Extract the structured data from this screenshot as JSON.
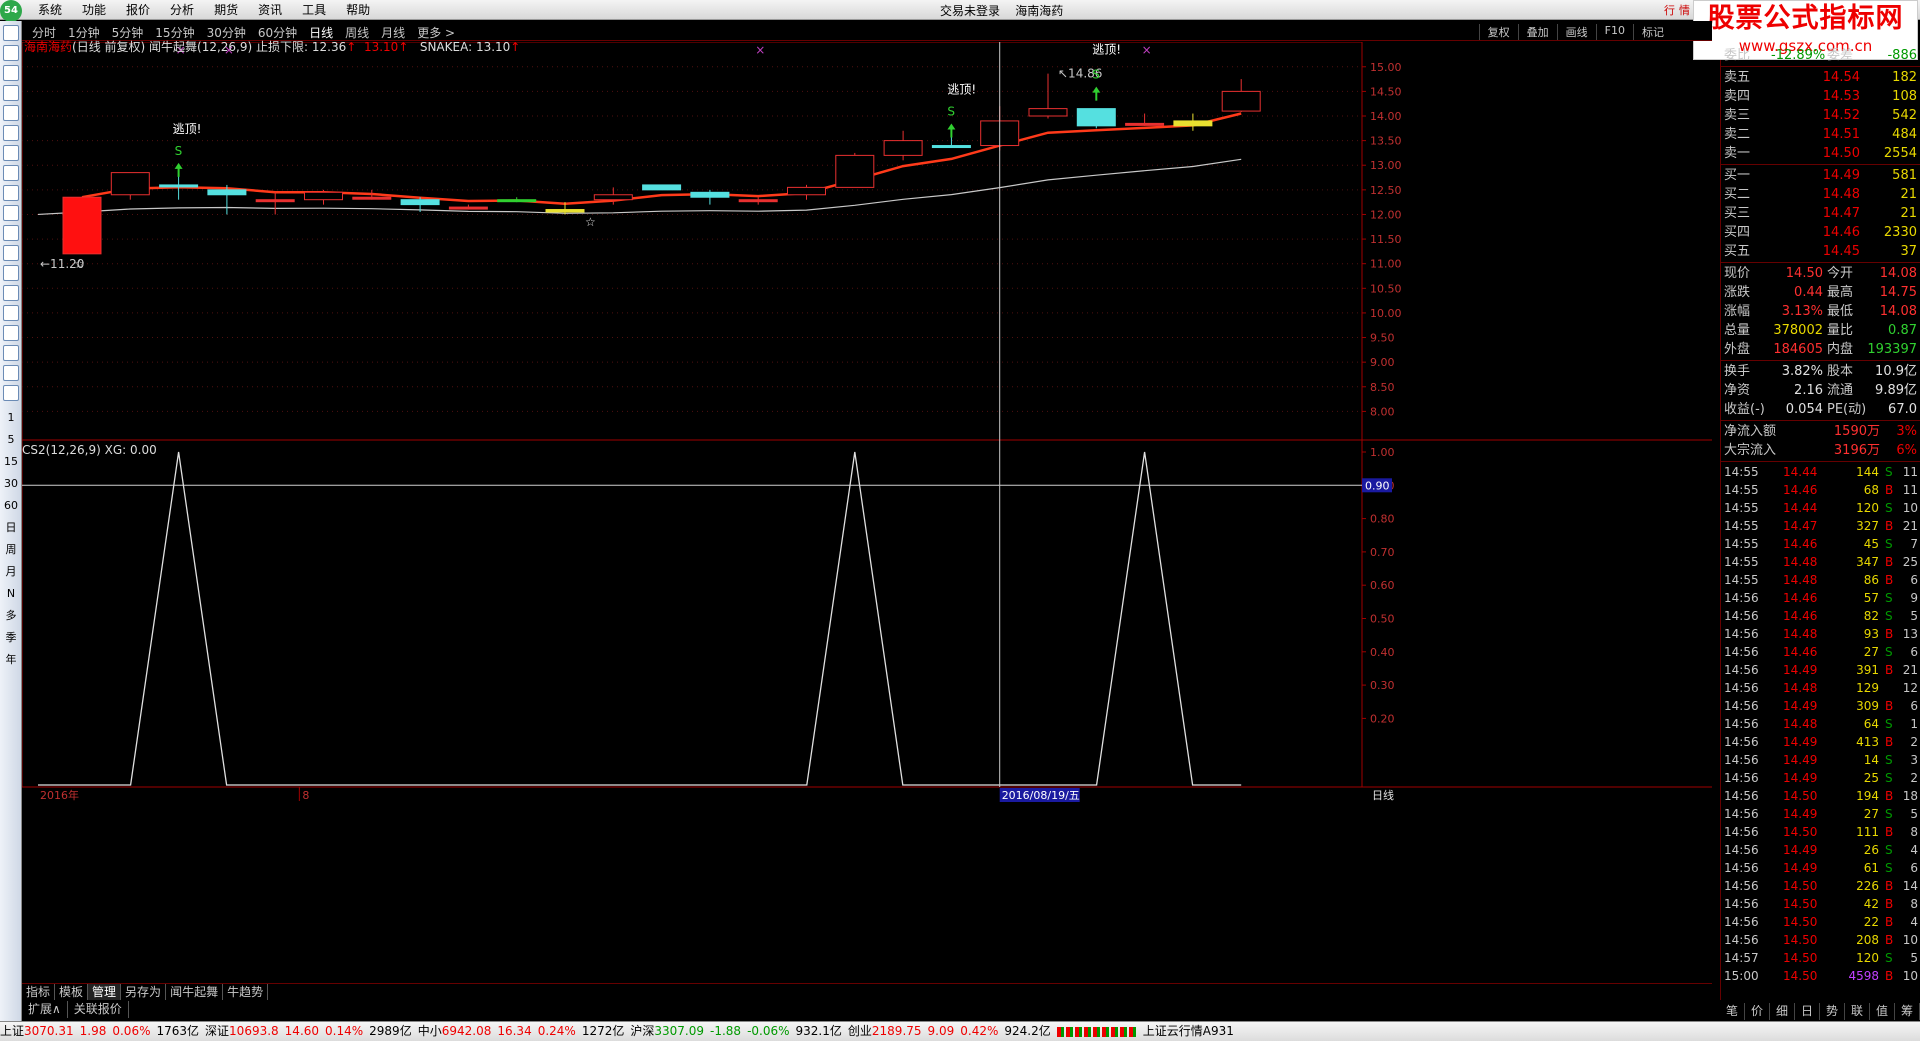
{
  "app": {
    "logo": "54",
    "menu": [
      "系统",
      "功能",
      "报价",
      "分析",
      "期货",
      "资讯",
      "工具",
      "帮助"
    ],
    "login_status": "交易未登录",
    "stock_name": "海南海药",
    "win_btns": [
      "行",
      "情"
    ]
  },
  "brand": {
    "title": "股票公式指标网",
    "url": "www.gszx.com.cn"
  },
  "periods": [
    "分时",
    "1分钟",
    "5分钟",
    "15分钟",
    "30分钟",
    "60分钟",
    "日线",
    "周线",
    "月线",
    "更多 >"
  ],
  "active_period": "日线",
  "tools": [
    "复权",
    "叠加",
    "画线",
    "F10",
    "标记"
  ],
  "left_periods": [
    "1",
    "5",
    "15",
    "30",
    "60",
    "日",
    "周",
    "月",
    "N",
    "多",
    "季",
    "年"
  ],
  "left_icons": [
    "up",
    "down",
    "k",
    "tbl",
    "line",
    "kline",
    "F10",
    "F",
    "bar",
    "F12",
    "F16",
    "clock",
    "wave",
    "RSI",
    "S",
    "move",
    "pen",
    "F5",
    "sync"
  ],
  "header": {
    "name": "海南海药",
    "desc": "(日线 前复权) 闻牛起舞(12,26,9)",
    "limit_label": "止损下限:",
    "limit_val": "12.36",
    "extra_val": "13.10",
    "snake": "SNAKEA: 13.10"
  },
  "chart_data": [
    {
      "type": "candlestick",
      "ylim": [
        7.5,
        15.3
      ],
      "yticks": [
        8.0,
        8.5,
        9.0,
        9.5,
        10.0,
        10.5,
        11.0,
        11.5,
        12.0,
        12.5,
        13.0,
        13.5,
        14.0,
        14.5,
        15.0
      ],
      "candles": [
        {
          "o": 11.2,
          "c": 12.35,
          "h": 12.35,
          "l": 11.2,
          "color": "red_fill"
        },
        {
          "o": 12.4,
          "c": 12.85,
          "h": 12.85,
          "l": 12.3,
          "color": "red"
        },
        {
          "o": 12.6,
          "c": 12.6,
          "h": 12.9,
          "l": 12.3,
          "color": "cyan_line"
        },
        {
          "o": 12.4,
          "c": 12.5,
          "h": 12.6,
          "l": 12.0,
          "color": "cyan"
        },
        {
          "o": 12.25,
          "c": 12.3,
          "h": 12.45,
          "l": 12.0,
          "color": "red_line"
        },
        {
          "o": 12.3,
          "c": 12.45,
          "h": 12.5,
          "l": 12.2,
          "color": "red"
        },
        {
          "o": 12.35,
          "c": 12.35,
          "h": 12.5,
          "l": 12.3,
          "color": "red_line"
        },
        {
          "o": 12.3,
          "c": 12.2,
          "h": 12.35,
          "l": 12.05,
          "color": "cyan"
        },
        {
          "o": 12.15,
          "c": 12.15,
          "h": 12.2,
          "l": 12.1,
          "color": "red_line"
        },
        {
          "o": 12.3,
          "c": 12.3,
          "h": 12.35,
          "l": 12.25,
          "color": "green_line"
        },
        {
          "o": 12.05,
          "c": 12.1,
          "h": 12.25,
          "l": 12.0,
          "color": "yellow"
        },
        {
          "o": 12.3,
          "c": 12.4,
          "h": 12.55,
          "l": 12.2,
          "color": "red"
        },
        {
          "o": 12.5,
          "c": 12.6,
          "h": 12.6,
          "l": 12.5,
          "color": "cyan"
        },
        {
          "o": 12.35,
          "c": 12.45,
          "h": 12.5,
          "l": 12.2,
          "color": "cyan"
        },
        {
          "o": 12.3,
          "c": 12.3,
          "h": 12.35,
          "l": 12.2,
          "color": "red_line"
        },
        {
          "o": 12.4,
          "c": 12.55,
          "h": 12.6,
          "l": 12.3,
          "color": "red"
        },
        {
          "o": 12.55,
          "c": 13.2,
          "h": 13.25,
          "l": 12.55,
          "color": "red"
        },
        {
          "o": 13.2,
          "c": 13.5,
          "h": 13.7,
          "l": 13.1,
          "color": "red"
        },
        {
          "o": 13.4,
          "c": 13.4,
          "h": 13.75,
          "l": 13.35,
          "color": "cyan_line"
        },
        {
          "o": 13.4,
          "c": 13.9,
          "h": 14.2,
          "l": 13.3,
          "color": "red"
        },
        {
          "o": 14.0,
          "c": 14.15,
          "h": 14.86,
          "l": 13.95,
          "color": "red"
        },
        {
          "o": 14.15,
          "c": 13.8,
          "h": 14.15,
          "l": 13.75,
          "color": "cyan"
        },
        {
          "o": 13.85,
          "c": 13.85,
          "h": 14.05,
          "l": 13.8,
          "color": "red_line"
        },
        {
          "o": 13.8,
          "c": 13.9,
          "h": 14.05,
          "l": 13.7,
          "color": "yellow"
        },
        {
          "o": 14.1,
          "c": 14.5,
          "h": 14.75,
          "l": 14.08,
          "color": "red"
        }
      ],
      "labels": {
        "low_mark": "11.20",
        "high_mark": "14.86",
        "escape": "逃顶!",
        "sell": "S"
      }
    },
    {
      "type": "line",
      "title": "CS2(12,26,9)  XG: 0.00",
      "ylim": [
        0,
        1.0
      ],
      "yticks": [
        0.2,
        0.3,
        0.4,
        0.5,
        0.6,
        0.7,
        0.8,
        0.9,
        1.0
      ],
      "hline": 0.9,
      "hline_label": "0.90",
      "peaks": [
        2,
        16,
        22
      ]
    }
  ],
  "x_axis": {
    "year_label": "2016年",
    "month_label": "8",
    "cursor_date": "2016/08/19/五",
    "right_label": "日线"
  },
  "quote": {
    "weibi": {
      "k": "委比",
      "v": "-12.89%",
      "k2": "委差",
      "v2": "-886"
    },
    "asks": [
      {
        "k": "卖五",
        "p": "14.54",
        "n": "182"
      },
      {
        "k": "卖四",
        "p": "14.53",
        "n": "108"
      },
      {
        "k": "卖三",
        "p": "14.52",
        "n": "542"
      },
      {
        "k": "卖二",
        "p": "14.51",
        "n": "484"
      },
      {
        "k": "卖一",
        "p": "14.50",
        "n": "2554"
      }
    ],
    "bids": [
      {
        "k": "买一",
        "p": "14.49",
        "n": "581"
      },
      {
        "k": "买二",
        "p": "14.48",
        "n": "21"
      },
      {
        "k": "买三",
        "p": "14.47",
        "n": "21"
      },
      {
        "k": "买四",
        "p": "14.46",
        "n": "2330"
      },
      {
        "k": "买五",
        "p": "14.45",
        "n": "37"
      }
    ],
    "stats": [
      {
        "k": "现价",
        "v": "14.50",
        "vc": "red",
        "k2": "今开",
        "v2": "14.08",
        "v2c": "red"
      },
      {
        "k": "涨跌",
        "v": "0.44",
        "vc": "red",
        "k2": "最高",
        "v2": "14.75",
        "v2c": "red"
      },
      {
        "k": "涨幅",
        "v": "3.13%",
        "vc": "red",
        "k2": "最低",
        "v2": "14.08",
        "v2c": "red"
      },
      {
        "k": "总量",
        "v": "378002",
        "vc": "yellow",
        "k2": "量比",
        "v2": "0.87",
        "v2c": "green"
      },
      {
        "k": "外盘",
        "v": "184605",
        "vc": "red",
        "k2": "内盘",
        "v2": "193397",
        "v2c": "green"
      }
    ],
    "stats2": [
      {
        "k": "换手",
        "v": "3.82%",
        "vc": "white",
        "k2": "股本",
        "v2": "10.9亿",
        "v2c": "white"
      },
      {
        "k": "净资",
        "v": "2.16",
        "vc": "white",
        "k2": "流通",
        "v2": "9.89亿",
        "v2c": "white"
      },
      {
        "k": "收益(-)",
        "v": "0.054",
        "vc": "white",
        "k2": "PE(动)",
        "v2": "67.0",
        "v2c": "white"
      }
    ],
    "flows": [
      {
        "k": "净流入额",
        "v": "1590万",
        "p": "3%"
      },
      {
        "k": "大宗流入",
        "v": "3196万",
        "p": "6%"
      }
    ]
  },
  "ticks": [
    {
      "t": "14:55",
      "p": "14.44",
      "q": "144",
      "d": "S",
      "c": "11"
    },
    {
      "t": "14:55",
      "p": "14.46",
      "q": "68",
      "d": "B",
      "c": "11"
    },
    {
      "t": "14:55",
      "p": "14.44",
      "q": "120",
      "d": "S",
      "c": "10"
    },
    {
      "t": "14:55",
      "p": "14.47",
      "q": "327",
      "d": "B",
      "c": "21"
    },
    {
      "t": "14:55",
      "p": "14.46",
      "q": "45",
      "d": "S",
      "c": "7"
    },
    {
      "t": "14:55",
      "p": "14.48",
      "q": "347",
      "d": "B",
      "c": "25"
    },
    {
      "t": "14:55",
      "p": "14.48",
      "q": "86",
      "d": "B",
      "c": "6"
    },
    {
      "t": "14:56",
      "p": "14.46",
      "q": "57",
      "d": "S",
      "c": "9"
    },
    {
      "t": "14:56",
      "p": "14.46",
      "q": "82",
      "d": "S",
      "c": "5"
    },
    {
      "t": "14:56",
      "p": "14.48",
      "q": "93",
      "d": "B",
      "c": "13"
    },
    {
      "t": "14:56",
      "p": "14.46",
      "q": "27",
      "d": "S",
      "c": "6"
    },
    {
      "t": "14:56",
      "p": "14.49",
      "q": "391",
      "d": "B",
      "c": "21"
    },
    {
      "t": "14:56",
      "p": "14.48",
      "q": "129",
      "d": "",
      "c": "12"
    },
    {
      "t": "14:56",
      "p": "14.49",
      "q": "309",
      "d": "B",
      "c": "6"
    },
    {
      "t": "14:56",
      "p": "14.48",
      "q": "64",
      "d": "S",
      "c": "1"
    },
    {
      "t": "14:56",
      "p": "14.49",
      "q": "413",
      "d": "B",
      "c": "2"
    },
    {
      "t": "14:56",
      "p": "14.49",
      "q": "14",
      "d": "S",
      "c": "3"
    },
    {
      "t": "14:56",
      "p": "14.49",
      "q": "25",
      "d": "S",
      "c": "2"
    },
    {
      "t": "14:56",
      "p": "14.50",
      "q": "194",
      "d": "B",
      "c": "18"
    },
    {
      "t": "14:56",
      "p": "14.49",
      "q": "27",
      "d": "S",
      "c": "5"
    },
    {
      "t": "14:56",
      "p": "14.50",
      "q": "111",
      "d": "B",
      "c": "8"
    },
    {
      "t": "14:56",
      "p": "14.49",
      "q": "26",
      "d": "S",
      "c": "4"
    },
    {
      "t": "14:56",
      "p": "14.49",
      "q": "61",
      "d": "S",
      "c": "6"
    },
    {
      "t": "14:56",
      "p": "14.50",
      "q": "226",
      "d": "B",
      "c": "14"
    },
    {
      "t": "14:56",
      "p": "14.50",
      "q": "42",
      "d": "B",
      "c": "8"
    },
    {
      "t": "14:56",
      "p": "14.50",
      "q": "22",
      "d": "B",
      "c": "4"
    },
    {
      "t": "14:56",
      "p": "14.50",
      "q": "208",
      "d": "B",
      "c": "10"
    },
    {
      "t": "14:57",
      "p": "14.50",
      "q": "120",
      "d": "S",
      "c": "5"
    },
    {
      "t": "15:00",
      "p": "14.50",
      "q": "4598",
      "d": "B",
      "c": "10"
    }
  ],
  "right_tabs": [
    "笔",
    "价",
    "细",
    "日",
    "势",
    "联",
    "值",
    "筹"
  ],
  "tabs1": [
    "指标",
    "模板",
    "管理",
    "另存为",
    "闻牛起舞",
    "牛趋势"
  ],
  "tabs1_active": "管理",
  "tabs2": [
    "扩展∧",
    "关联报价"
  ],
  "status": [
    {
      "k": "上证",
      "v": "3070.31",
      "c": "1.98",
      "p": "0.06%",
      "a": "1763亿"
    },
    {
      "k": "深证",
      "v": "10693.8",
      "c": "14.60",
      "p": "0.14%",
      "a": "2989亿"
    },
    {
      "k": "中小",
      "v": "6942.08",
      "c": "16.34",
      "p": "0.24%",
      "a": "1272亿"
    },
    {
      "k": "沪深",
      "v": "3307.09",
      "c": "-1.88",
      "p": "-0.06%",
      "a": "932.1亿"
    },
    {
      "k": "创业",
      "v": "2189.75",
      "c": "9.09",
      "p": "0.42%",
      "a": "924.2亿"
    }
  ],
  "status_tail": "上证云行情A931",
  "colors": {
    "up": "#e83030",
    "down": "#55e0e0",
    "ma1": "#ff3a1a",
    "ma2": "#c8c8c8",
    "axis": "#a00000",
    "grid": "#501010"
  }
}
